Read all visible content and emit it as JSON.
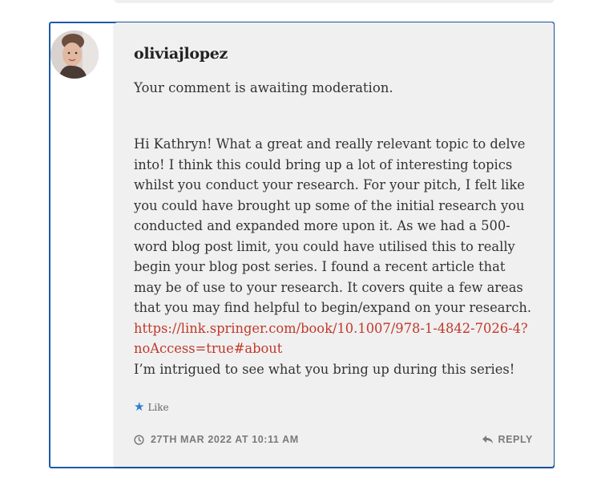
{
  "comment": {
    "author": "oliviajlopez",
    "moderation_notice": "Your comment is awaiting moderation.",
    "body": "Hi Kathryn! What a great and really relevant topic to delve into! I think this could bring up a lot of interesting topics whilst you conduct your research. For your pitch, I felt like you could have brought up some of the initial research you conducted and expanded more upon it. As we had a 500-word blog post limit, you could have utilised this to really begin your blog post series. I found a recent article that may be of use to your research. It covers quite a few areas that you may find helpful to begin/expand on your research.",
    "link": "https://link.springer.com/book/10.1007/978-1-4842-7026-4?noAccess=true#about",
    "closing": "I’m intrigued to see what you bring up during this series!",
    "like_label": "Like",
    "timestamp": "27TH MAR 2022 AT 10:11 AM",
    "reply_label": "REPLY"
  },
  "icons": {
    "like": "star-icon",
    "time": "clock-icon",
    "reply": "reply-arrow-icon"
  },
  "colors": {
    "border_accent": "#1e5aa8",
    "link": "#c0392b",
    "like_star": "#2a7fd4",
    "card_bg": "#f0f0f0"
  }
}
